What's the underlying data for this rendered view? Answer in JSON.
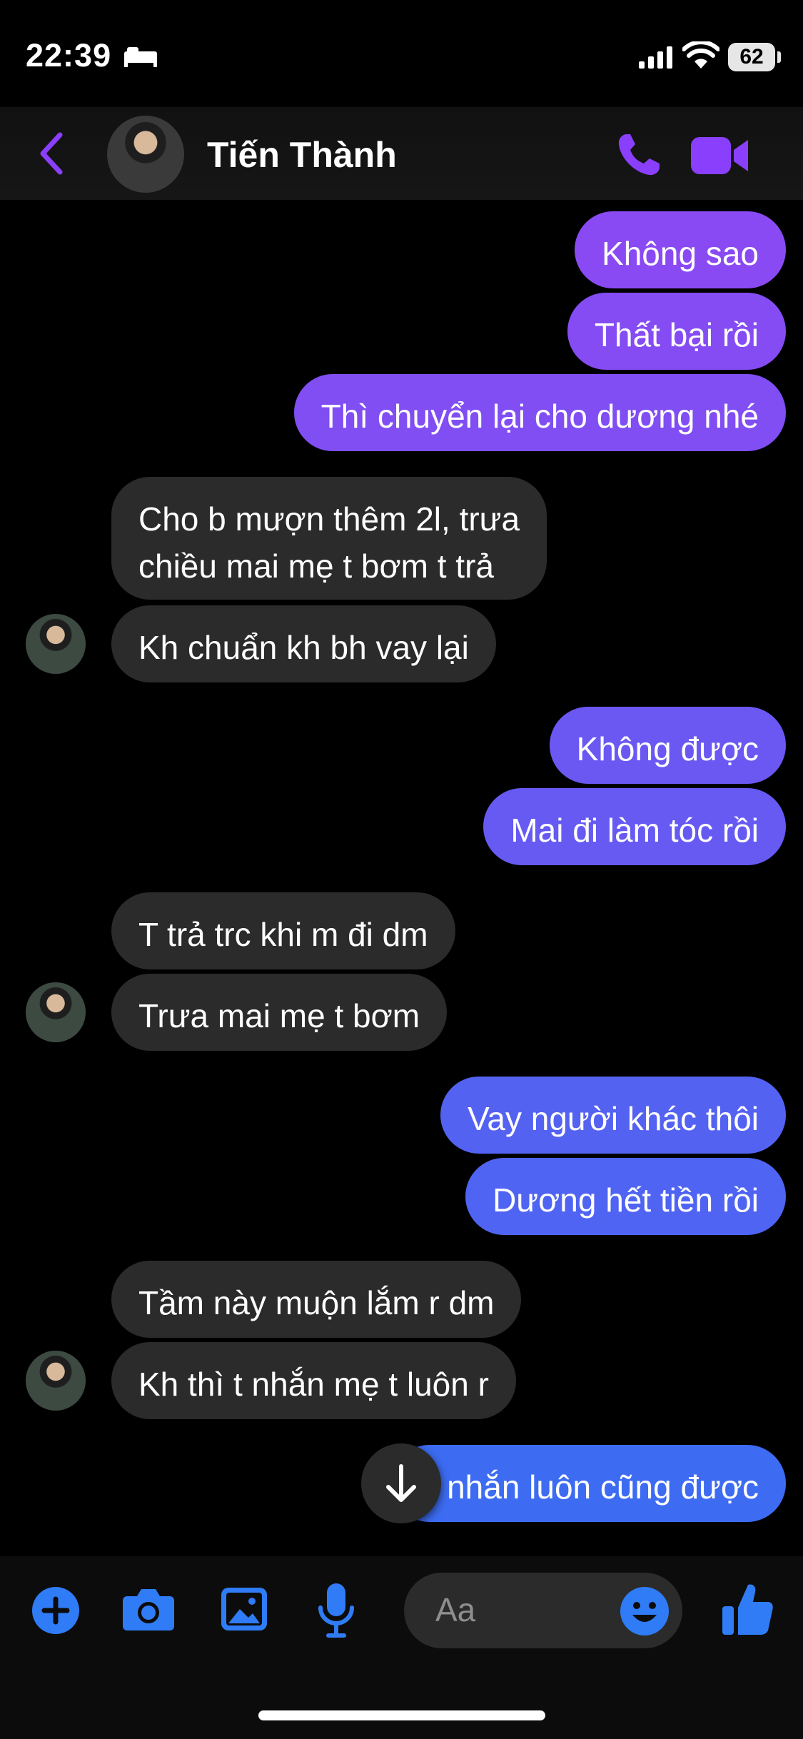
{
  "status_bar": {
    "time": "22:39",
    "battery": "62"
  },
  "header": {
    "contact_name": "Tiến Thành"
  },
  "messages": [
    {
      "dir": "out",
      "text": "Không sao"
    },
    {
      "dir": "out",
      "text": "Thất bại rồi"
    },
    {
      "dir": "out",
      "text": "Thì chuyển lại cho dương nhé"
    },
    {
      "dir": "in",
      "text": "Cho b mượn thêm 2l, trưa\nchiều mai mẹ t bơm t trả"
    },
    {
      "dir": "in",
      "text": "Kh chuẩn kh bh vay lại"
    },
    {
      "dir": "out",
      "text": "Không được"
    },
    {
      "dir": "out",
      "text": "Mai đi làm tóc rồi"
    },
    {
      "dir": "in",
      "text": "T trả trc khi m đi dm"
    },
    {
      "dir": "in",
      "text": "Trưa mai mẹ t bơm"
    },
    {
      "dir": "out",
      "text": "Vay người khác thôi"
    },
    {
      "dir": "out",
      "text": "Dương hết tiền rồi"
    },
    {
      "dir": "in",
      "text": "Tầm này muộn lắm r dm"
    },
    {
      "dir": "in",
      "text": "Kh thì t nhắn mẹ t luôn r"
    },
    {
      "dir": "out",
      "text": "T nhắn luôn cũng được"
    }
  ],
  "composer": {
    "placeholder": "Aa"
  },
  "colors": {
    "accent": "#8a3ffc",
    "outgoing_top": "#8a4af3",
    "outgoing_bottom": "#3d6cf2",
    "incoming": "#2b2b2b"
  },
  "icons": [
    "back-chevron-icon",
    "phone-icon",
    "video-icon",
    "plus-icon",
    "camera-icon",
    "gallery-icon",
    "microphone-icon",
    "emoji-icon",
    "thumbs-up-icon",
    "arrow-down-icon"
  ]
}
